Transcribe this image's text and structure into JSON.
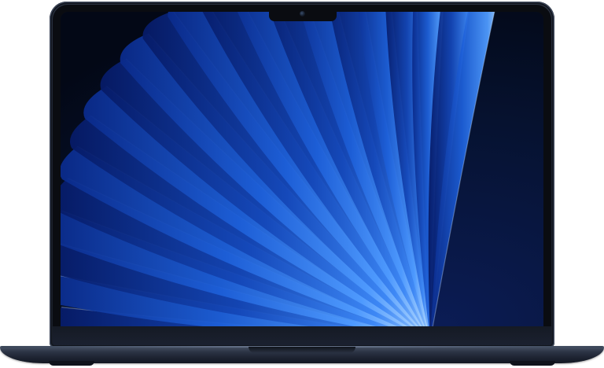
{
  "device": {
    "icon": "laptop-icon",
    "colors": {
      "body": "#1d2330",
      "bezel": "#0a0c11",
      "base": "#2b3344"
    }
  },
  "wallpaper": {
    "icon": "fan-petals-wallpaper",
    "colors": {
      "background": "#061230",
      "deep": "#0a2a8a",
      "mid": "#1d5fd8",
      "light": "#4f9bff",
      "highlight": "#bfe0ff"
    }
  }
}
